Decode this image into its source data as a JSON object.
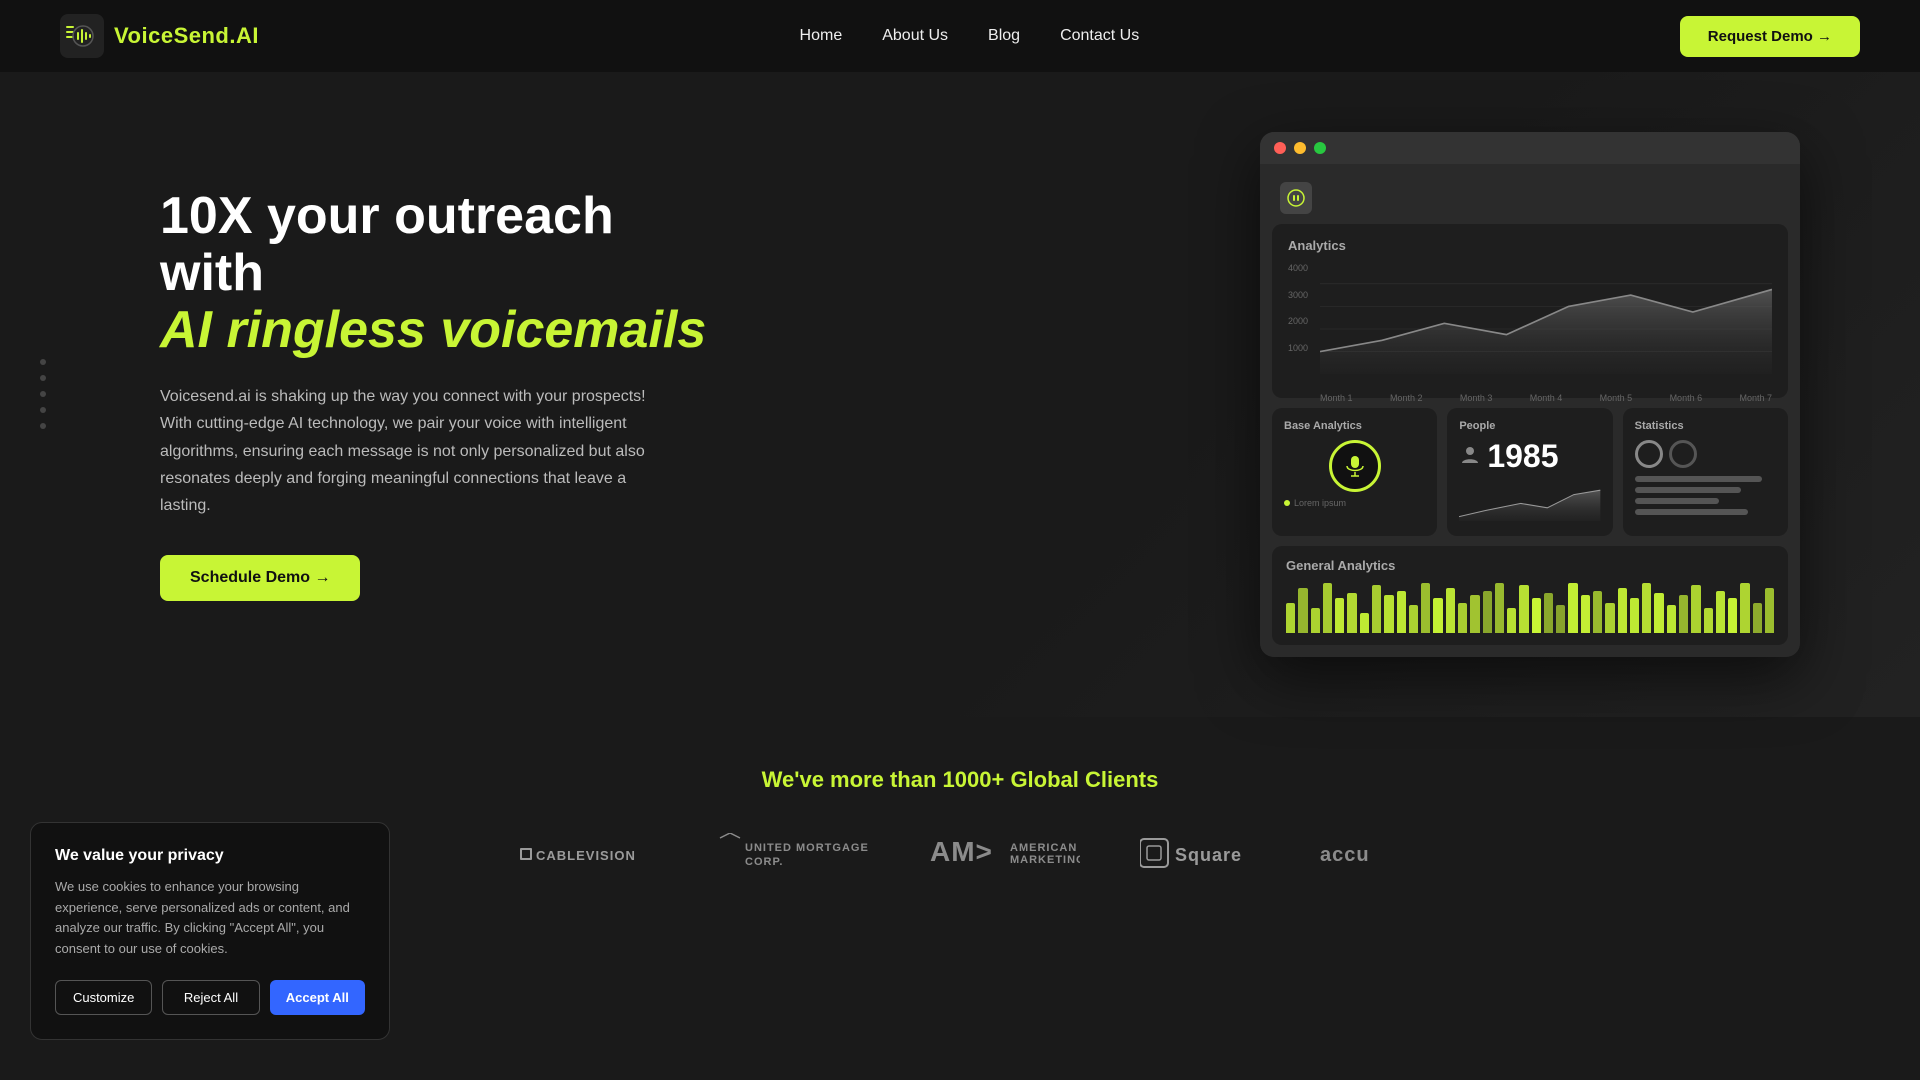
{
  "nav": {
    "logo_text": "VoiceSend.",
    "logo_accent": "AI",
    "links": [
      {
        "label": "Home",
        "id": "home"
      },
      {
        "label": "About Us",
        "id": "about"
      },
      {
        "label": "Blog",
        "id": "blog"
      },
      {
        "label": "Contact Us",
        "id": "contact"
      }
    ],
    "demo_button": "Request Demo →"
  },
  "hero": {
    "title_line1": "10X your outreach with",
    "title_line2": "AI ringless voicemails",
    "description": "Voicesend.ai is shaking up the way you connect with your prospects! With cutting-edge AI technology, we pair your voice with intelligent algorithms, ensuring each message is not only personalized but also resonates deeply and  forging meaningful connections that leave a lasting.",
    "schedule_button": "Schedule Demo →"
  },
  "dashboard": {
    "browser_dots": [
      "red",
      "yellow",
      "green"
    ],
    "analytics_title": "Analytics",
    "chart_months": [
      "Month 1",
      "Month 2",
      "Month 3",
      "Month 4",
      "Month 5",
      "Month 6",
      "Month 7"
    ],
    "chart_y_labels": [
      "4000",
      "3000",
      "2000",
      "1000"
    ],
    "base_analytics": {
      "title": "Base Analytics",
      "lorem": "Lorem ipsum"
    },
    "people": {
      "title": "People",
      "count": "1985"
    },
    "statistics": {
      "title": "Statistics"
    },
    "general_analytics": {
      "title": "General Analytics"
    }
  },
  "clients": {
    "headline_prefix": "We've more than ",
    "headline_count": "1000+",
    "headline_suffix": " Global Clients",
    "logos": [
      {
        "name": "Cablevision",
        "text": "CABLEVISION"
      },
      {
        "name": "United Mortgage Corp",
        "text": "UNITED MORTGAGE CORP."
      },
      {
        "name": "American Marketing Association",
        "text": "AM> AMA"
      },
      {
        "name": "Square",
        "text": "⊡ Square"
      },
      {
        "name": "Accu",
        "text": "accu"
      }
    ]
  },
  "cookie": {
    "title": "We value your privacy",
    "description": "We use cookies to enhance your browsing experience, serve personalized ads or content, and analyze our traffic. By clicking \"Accept All\", you consent to our use of cookies.",
    "customize_label": "Customize",
    "reject_label": "Reject All",
    "accept_label": "Accept All"
  }
}
